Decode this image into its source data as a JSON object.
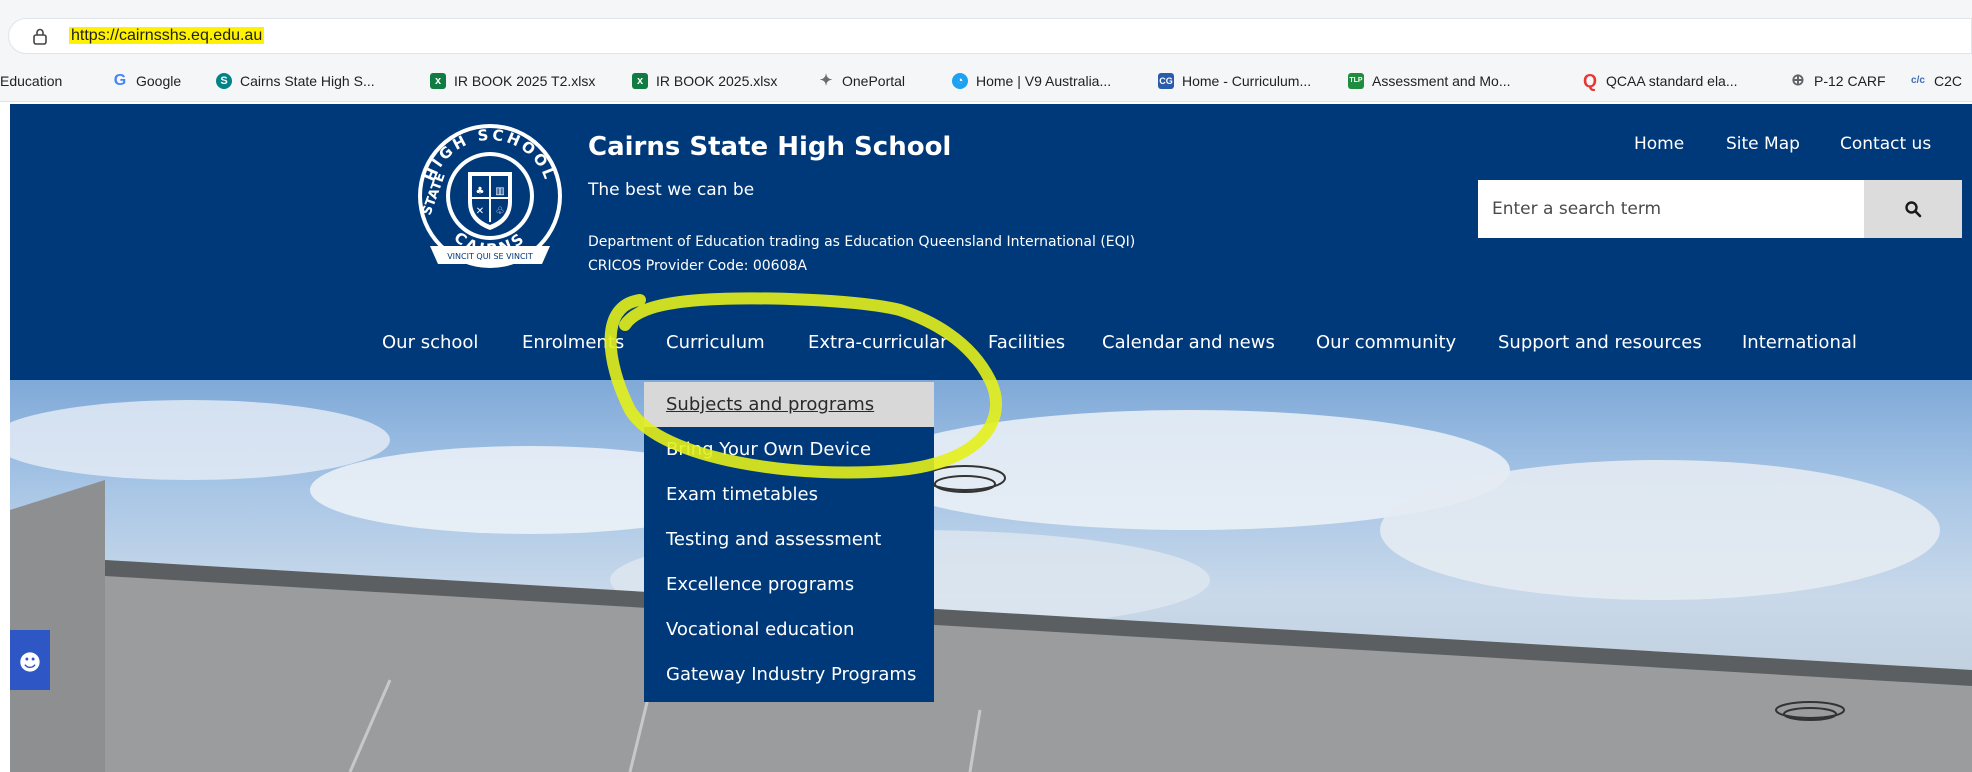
{
  "browser": {
    "url": "https://cairnsshs.eq.edu.au",
    "url_highlight_color": "#fff200",
    "bookmarks": [
      {
        "label": "Education",
        "icon": "education-icon"
      },
      {
        "label": "Google",
        "icon": "google-icon",
        "color": "#4285f4"
      },
      {
        "label": "Cairns State High S...",
        "icon": "sharepoint-icon",
        "color": "#038387"
      },
      {
        "label": "IR BOOK 2025 T2.xlsx",
        "icon": "excel-icon",
        "color": "#107c41"
      },
      {
        "label": "IR BOOK 2025.xlsx",
        "icon": "excel-icon",
        "color": "#107c41"
      },
      {
        "label": "OnePortal",
        "icon": "oneportal-icon",
        "color": "#6b6b6b"
      },
      {
        "label": "Home | V9 Australia...",
        "icon": "v9-icon",
        "color": "#1da1f2"
      },
      {
        "label": "Home - Curriculum...",
        "icon": "cg-icon",
        "color": "#2b5cab"
      },
      {
        "label": "Assessment and Mo...",
        "icon": "tlp-icon",
        "color": "#1e8e3e"
      },
      {
        "label": "QCAA standard ela...",
        "icon": "qcaa-icon",
        "color": "#e53935"
      },
      {
        "label": "P-12 CARF",
        "icon": "globe-icon",
        "color": "#5f6368"
      },
      {
        "label": "C2C",
        "icon": "c2c-icon",
        "color": "#3b6fb6"
      }
    ]
  },
  "header": {
    "school_name": "Cairns State High School",
    "tagline": "The best we can be",
    "dept_line": "Department of Education trading as Education Queensland International (EQI)",
    "cricos_line": "CRICOS Provider Code: 00608A",
    "logo_text_top": "HIGH SCHOOL",
    "logo_text_left": "STATE",
    "logo_text_bottom": "CAIRNS",
    "logo_motto": "VINCIT QUI SE VINCIT",
    "top_links": [
      "Home",
      "Site Map",
      "Contact us"
    ],
    "search_placeholder": "Enter a search term",
    "brand_color": "#00397a"
  },
  "nav": {
    "items": [
      "Our school",
      "Enrolments",
      "Curriculum",
      "Extra-curricular",
      "Facilities",
      "Calendar and news",
      "Our community",
      "Support and resources",
      "International"
    ]
  },
  "dropdown": {
    "items": [
      "Subjects and programs",
      "Bring Your Own Device",
      "Exam timetables",
      "Testing and assessment",
      "Excellence programs",
      "Vocational education",
      "Gateway Industry Programs"
    ],
    "active_index": 0
  },
  "annotation": {
    "color": "#e3ef1a"
  }
}
